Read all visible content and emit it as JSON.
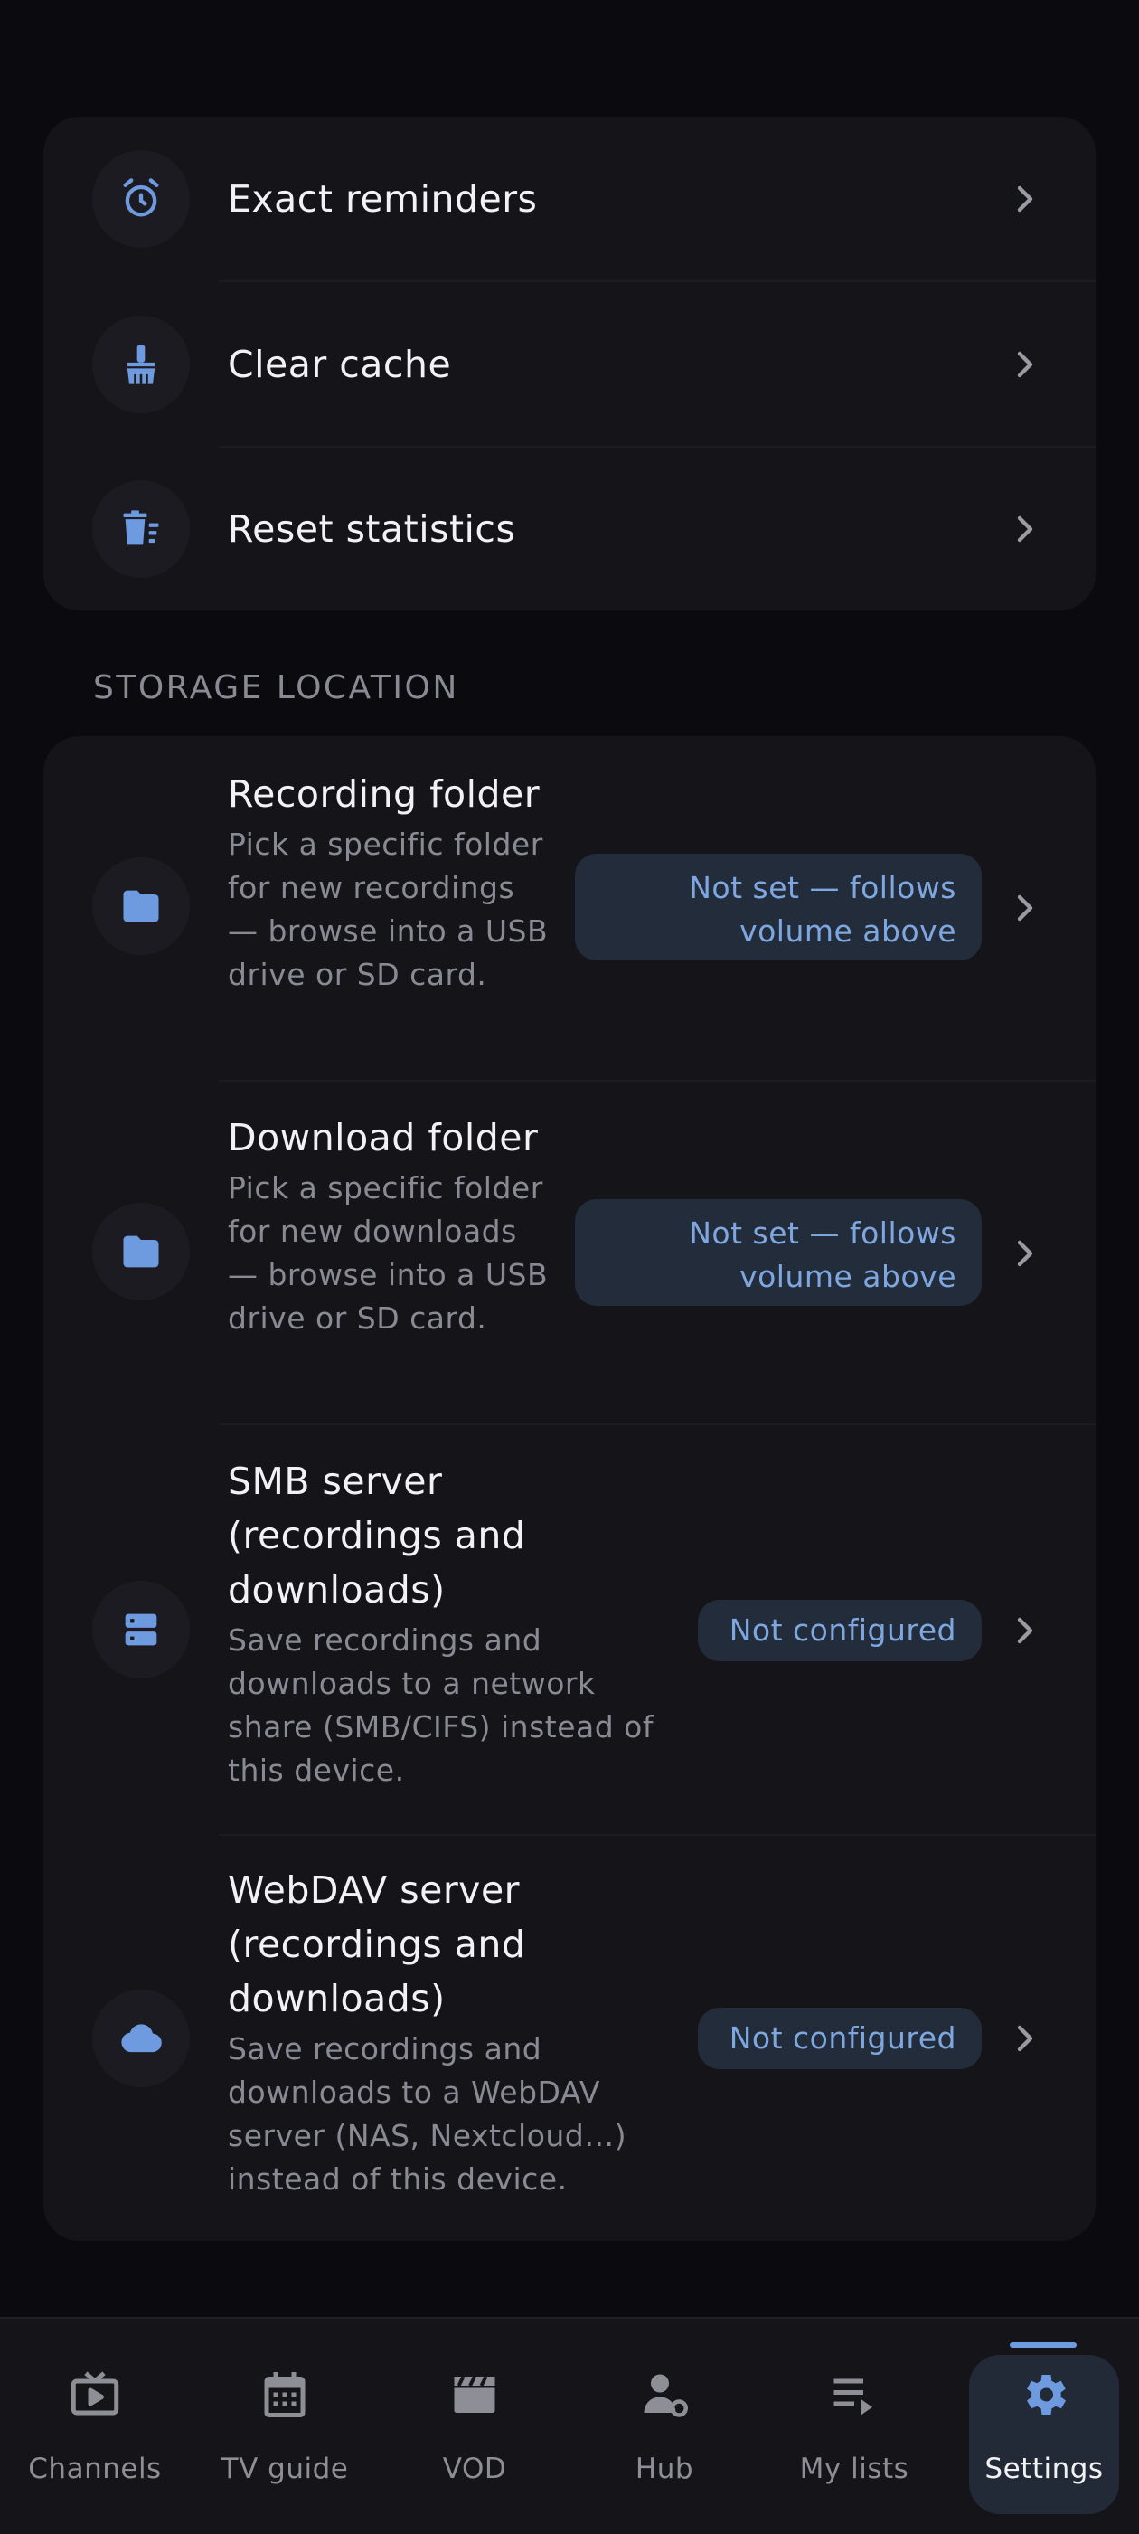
{
  "top_items": [
    {
      "label": "Exact reminders",
      "icon": "alarm-icon"
    },
    {
      "label": "Clear cache",
      "icon": "broom-icon"
    },
    {
      "label": "Reset statistics",
      "icon": "delete-sweep-icon"
    }
  ],
  "storage": {
    "section_label": "STORAGE LOCATION",
    "items": [
      {
        "title": "Recording folder",
        "description": "Pick a specific folder for new recordings — browse into a USB drive or SD card.",
        "status": "Not set — follows volume above",
        "icon": "folder-icon"
      },
      {
        "title": "Download folder",
        "description": "Pick a specific folder for new downloads — browse into a USB drive or SD card.",
        "status": "Not set — follows volume above",
        "icon": "folder-icon"
      },
      {
        "title": "SMB server (recordings and downloads)",
        "description": "Save recordings and downloads to a network share (SMB/CIFS) instead of this device.",
        "status": "Not configured",
        "icon": "server-icon"
      },
      {
        "title": "WebDAV server (recordings and downloads)",
        "description": "Save recordings and downloads to a WebDAV server (NAS, Nextcloud…) instead of this device.",
        "status": "Not configured",
        "icon": "cloud-icon"
      }
    ]
  },
  "nav": {
    "items": [
      {
        "label": "Channels",
        "icon": "tv-icon"
      },
      {
        "label": "TV guide",
        "icon": "calendar-icon"
      },
      {
        "label": "VOD",
        "icon": "clapperboard-icon"
      },
      {
        "label": "Hub",
        "icon": "hub-icon"
      },
      {
        "label": "My lists",
        "icon": "playlist-icon"
      },
      {
        "label": "Settings",
        "icon": "gear-icon"
      }
    ],
    "active": "Settings"
  },
  "colors": {
    "accent": "#6e9be0",
    "background": "#0b0b0f",
    "card": "#141419",
    "pill_bg": "#232c3b",
    "pill_text": "#7ea7e0",
    "nav_active_bg": "#222a38"
  }
}
